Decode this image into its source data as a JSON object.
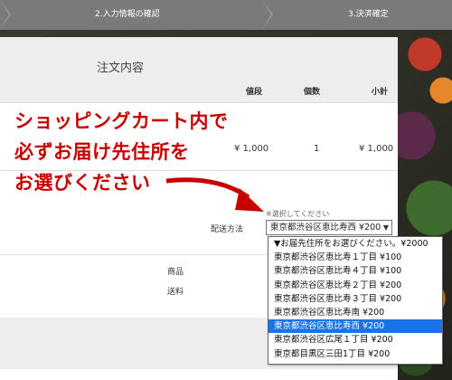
{
  "steps": [
    {
      "label": "2.入力情報の確認"
    },
    {
      "label": "3.決済確定"
    }
  ],
  "order": {
    "title": "注文内容",
    "columns": {
      "price": "値段",
      "qty": "個数",
      "subtotal": "小計"
    },
    "row": {
      "price": "¥ 1,000",
      "qty": "1",
      "subtotal": "¥ 1,000"
    }
  },
  "annotation": {
    "line1": "ショッピングカート内で",
    "line2": "必ずお届け先住所を",
    "line3": "お選びください"
  },
  "shipping": {
    "hint": "※選択してください",
    "label": "配送方法",
    "selected": "東京都渋谷区恵比寿西 ¥200",
    "options": [
      "▼お届先住所をお選びください。¥2000",
      "東京都渋谷区恵比寿１丁目 ¥100",
      "東京都渋谷区恵比寿４丁目 ¥100",
      "東京都渋谷区恵比寿２丁目 ¥200",
      "東京都渋谷区恵比寿３丁目 ¥200",
      "東京都渋谷区恵比寿南 ¥200",
      "東京都渋谷区恵比寿西 ¥200",
      "東京都渋谷区広尾１丁目 ¥200",
      "東京都目黒区三田1丁目 ¥200"
    ],
    "selected_index": 6
  },
  "summary": {
    "goods": "商品",
    "shipping_fee": "送料"
  },
  "colors": {
    "annotation": "#c70000",
    "highlight": "#1a73e8"
  }
}
